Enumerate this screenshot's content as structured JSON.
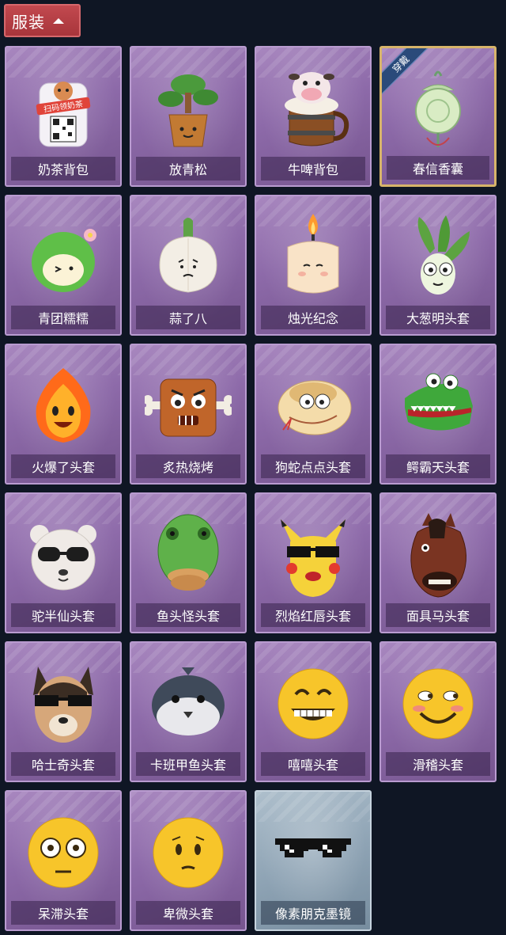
{
  "header": {
    "title": "服装"
  },
  "equipped_badge": "穿戴",
  "items": [
    {
      "label": "奶茶背包",
      "icon": "milk-tea-backpack-icon",
      "sticker_text": "扫码领奶茶"
    },
    {
      "label": "放青松",
      "icon": "pine-bonsai-icon"
    },
    {
      "label": "牛啤背包",
      "icon": "cow-beer-mug-icon"
    },
    {
      "label": "春信香囊",
      "icon": "sachet-pouch-icon",
      "equipped": true
    },
    {
      "label": "青团糯糯",
      "icon": "green-rice-ball-head-icon"
    },
    {
      "label": "蒜了八",
      "icon": "garlic-head-icon"
    },
    {
      "label": "烛光纪念",
      "icon": "candle-head-icon"
    },
    {
      "label": "大葱明头套",
      "icon": "scallion-head-icon"
    },
    {
      "label": "火爆了头套",
      "icon": "fire-head-icon"
    },
    {
      "label": "炙热烧烤",
      "icon": "bbq-meat-head-icon"
    },
    {
      "label": "狗蛇点点头套",
      "icon": "snake-head-icon"
    },
    {
      "label": "鳄霸天头套",
      "icon": "crocodile-head-icon"
    },
    {
      "label": "驼半仙头套",
      "icon": "bear-sunglasses-head-icon"
    },
    {
      "label": "鱼头怪头套",
      "icon": "fish-head-icon"
    },
    {
      "label": "烈焰红唇头套",
      "icon": "yellow-mascot-head-icon"
    },
    {
      "label": "面具马头套",
      "icon": "horse-mask-icon"
    },
    {
      "label": "哈士奇头套",
      "icon": "husky-head-icon"
    },
    {
      "label": "卡班甲鱼头套",
      "icon": "puffer-fish-head-icon"
    },
    {
      "label": "嘻嘻头套",
      "icon": "grin-emoji-head-icon"
    },
    {
      "label": "滑稽头套",
      "icon": "smirk-emoji-head-icon"
    },
    {
      "label": "呆滞头套",
      "icon": "stare-emoji-head-icon"
    },
    {
      "label": "卑微头套",
      "icon": "timid-emoji-head-icon"
    },
    {
      "label": "像素朋克墨镜",
      "icon": "pixel-sunglasses-icon",
      "theme": "blue"
    }
  ]
}
